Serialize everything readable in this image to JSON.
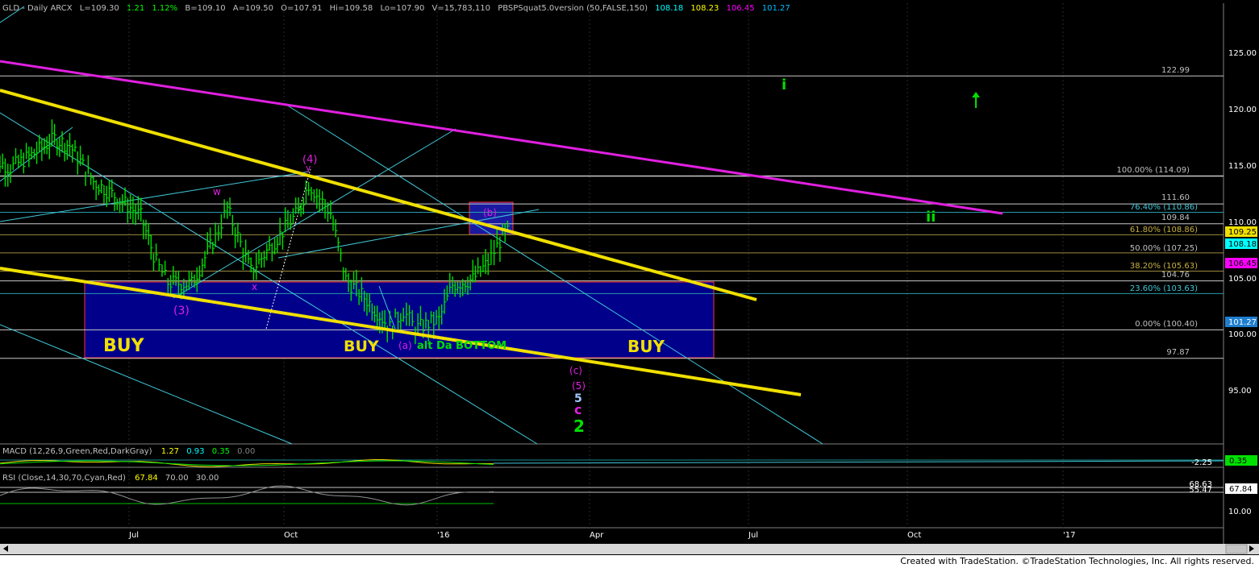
{
  "header": {
    "symbol": "GLD - Daily ARCX",
    "last": "L=109.30",
    "chg": "1.21",
    "pct": "1.12%",
    "bid": "B=109.10",
    "ask": "A=109.50",
    "open": "O=107.91",
    "high": "Hi=109.58",
    "low": "Lo=107.90",
    "vol": "V=15,783,110",
    "study": "PBSPSquat5.0version (50,FALSE,150)",
    "v1": "108.18",
    "v2": "108.23",
    "v3": "106.45",
    "v4": "101.27"
  },
  "macd_label": {
    "name": "MACD (12,26,9,Green,Red,DarkGray)",
    "a": "1.27",
    "b": "0.93",
    "c": "0.35",
    "d": "0.00"
  },
  "rsi_label": {
    "name": "RSI (Close,14,30,70,Cyan,Red)",
    "a": "67.84",
    "b": "70.00",
    "c": "30.00"
  },
  "footer": "Created with TradeStation. ©TradeStation Technologies, Inc. All rights reserved.",
  "chart_data": {
    "type": "line",
    "symbol": "GLD",
    "title": "GLD - Daily ARCX",
    "x_ticks": [
      "Jul",
      "Oct",
      "'16",
      "Apr",
      "Jul",
      "Oct",
      "'17"
    ],
    "y_ticks": [
      95.0,
      100.0,
      105.0,
      110.0,
      115.0,
      120.0,
      125.0
    ],
    "ylim": [
      90.5,
      129.0
    ],
    "series": [
      {
        "name": "GLD",
        "points": [
          [
            "2015-04-08",
            115.9
          ],
          [
            "2015-04-22",
            114.8
          ],
          [
            "2015-05-06",
            116.1
          ],
          [
            "2015-05-18",
            117.4
          ],
          [
            "2015-05-27",
            116.8
          ],
          [
            "2015-06-10",
            113.6
          ],
          [
            "2015-06-24",
            112.2
          ],
          [
            "2015-07-08",
            110.5
          ],
          [
            "2015-07-17",
            106.4
          ],
          [
            "2015-07-24",
            104.6
          ],
          [
            "2015-08-07",
            104.5
          ],
          [
            "2015-08-21",
            108.7
          ],
          [
            "2015-08-28",
            111.2
          ],
          [
            "2015-09-11",
            105.6
          ],
          [
            "2015-09-25",
            108.3
          ],
          [
            "2015-10-09",
            110.9
          ],
          [
            "2015-10-15",
            113.4
          ],
          [
            "2015-10-28",
            110.8
          ],
          [
            "2015-11-06",
            104.9
          ],
          [
            "2015-11-20",
            102.8
          ],
          [
            "2015-12-02",
            100.6
          ],
          [
            "2015-12-10",
            102.1
          ],
          [
            "2015-12-17",
            100.5
          ],
          [
            "2015-12-31",
            101.3
          ],
          [
            "2016-01-08",
            104.4
          ],
          [
            "2016-01-20",
            104.9
          ],
          [
            "2016-01-29",
            106.4
          ],
          [
            "2016-02-05",
            108.3
          ],
          [
            "2016-02-11",
            109.3
          ]
        ]
      }
    ],
    "fib_levels": [
      {
        "label": "100.00% (114.09)",
        "value": 114.09
      },
      {
        "label": "76.40% (110.86)",
        "value": 110.86
      },
      {
        "label": "61.80% (108.86)",
        "value": 108.86
      },
      {
        "label": "50.00% (107.25)",
        "value": 107.25
      },
      {
        "label": "38.20% (105.63)",
        "value": 105.63
      },
      {
        "label": "23.60% (103.63)",
        "value": 103.63
      },
      {
        "label": "0.00% (100.40)",
        "value": 100.4
      }
    ],
    "price_levels": [
      "122.99",
      "111.60",
      "109.84",
      "104.76",
      "97.87"
    ],
    "right_badges": [
      "109.25",
      "108.18",
      "106.45",
      "101.27"
    ],
    "annotations": [
      "(3)",
      "w",
      "x",
      "y",
      "(4)",
      "(b)",
      "(a)",
      "alt Da BOTTOM",
      "(c)",
      "(5)",
      "5",
      "c",
      "2",
      "i",
      "ii"
    ],
    "zone_labels": [
      "BUY",
      "BUY",
      "BUY"
    ],
    "macd_axis": "-2.25",
    "macd_badge": "0.35",
    "rsi_axis": [
      "68.63",
      "55.47",
      "10.00"
    ],
    "rsi_badge": "67.84"
  }
}
